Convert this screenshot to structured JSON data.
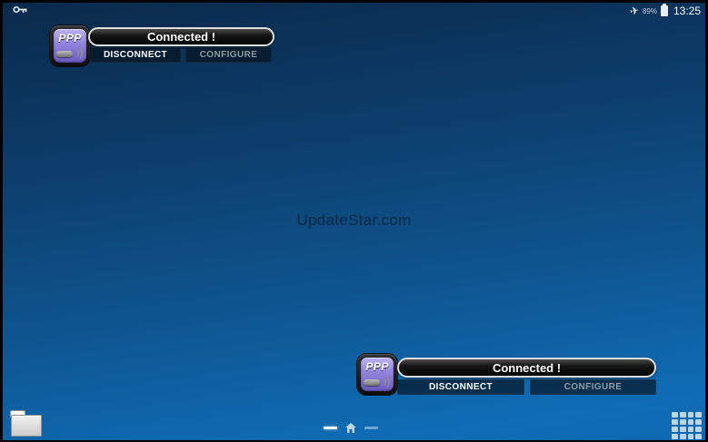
{
  "status_bar": {
    "time": "13:25",
    "battery_percent": "89%",
    "airplane_glyph": "✈"
  },
  "widgets": [
    {
      "icon_text": "PPP",
      "status_label": "Connected !",
      "disconnect_label": "DISCONNECT",
      "configure_label": "CONFIGURE"
    },
    {
      "icon_text": "PPP",
      "status_label": "Connected !",
      "disconnect_label": "DISCONNECT",
      "configure_label": "CONFIGURE"
    }
  ],
  "watermark": {
    "text": "UpdateStar.com"
  },
  "icons": {
    "key": "key-icon",
    "airplane": "airplane-icon",
    "battery": "battery-icon",
    "folder": "folder-icon",
    "home": "home-icon",
    "apps_grid": "apps-grid-icon"
  },
  "colors": {
    "background_top": "#0a2a4b",
    "background_bottom": "#0f6db6",
    "widget_icon_purple": "#8d7fd9",
    "status_pill_border": "#dcdcdc",
    "disconnect_text": "#ffffff",
    "configure_text": "#909aa1",
    "dock_icon_blue": "#bdd4e5"
  }
}
